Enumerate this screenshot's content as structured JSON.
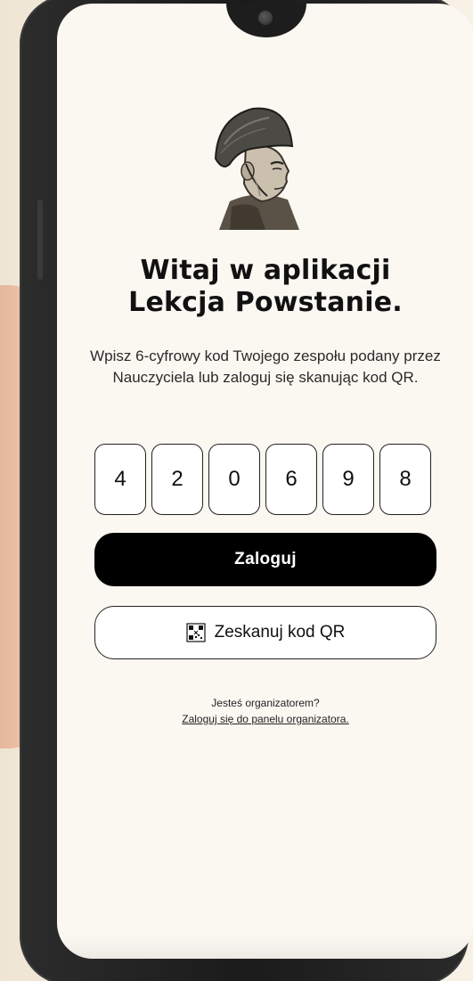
{
  "screen": {
    "title_line1": "Witaj w aplikacji",
    "title_line2": "Lekcja Powstanie.",
    "subtitle": "Wpisz 6-cyfrowy kod Twojego zespołu podany przez Nauczyciela lub zaloguj się skanując kod QR.",
    "code_digits": [
      "4",
      "2",
      "0",
      "6",
      "9",
      "8"
    ],
    "login_button_label": "Zaloguj",
    "scan_button_label": "Zeskanuj kod QR",
    "organizer_question": "Jesteś organizatorem?",
    "organizer_link": "Zaloguj się do panelu organizatora."
  },
  "icons": {
    "avatar": "soldier-helmet-portrait",
    "scan": "qr-code-icon"
  },
  "colors": {
    "primary_button": "#000000",
    "primary_button_text": "#ffffff",
    "screen_background": "#fbf8f2"
  }
}
